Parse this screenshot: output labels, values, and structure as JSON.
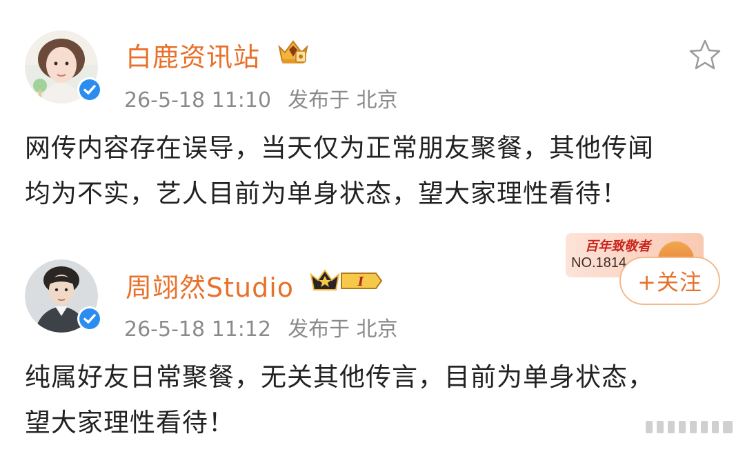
{
  "posts": [
    {
      "author": "白鹿资讯站",
      "time": "26-5-18 11:10",
      "location": "发布于 北京",
      "content_lines": [
        "网传内容存在误导，当天仅为正常朋友聚餐，其他传闻",
        "均为不实，艺人目前为单身状态，望大家理性看待！"
      ]
    },
    {
      "author": "周翊然Studio",
      "time": "26-5-18 11:12",
      "location": "发布于 北京",
      "content_lines": [
        "纯属好友日常聚餐，无关其他传言，目前为单身状态，",
        "望大家理性看待！"
      ],
      "badge_text": "I",
      "follow_label": "+关注",
      "promo": {
        "title": "百年致敬者",
        "number": "NO.1814"
      }
    }
  ],
  "icons": {
    "favorite": "star-outline-icon",
    "verified": "verified-check-icon"
  },
  "colors": {
    "author_name": "#e8702a",
    "meta": "#8a8a8a",
    "text": "#222222",
    "verified": "#2b8df0"
  }
}
